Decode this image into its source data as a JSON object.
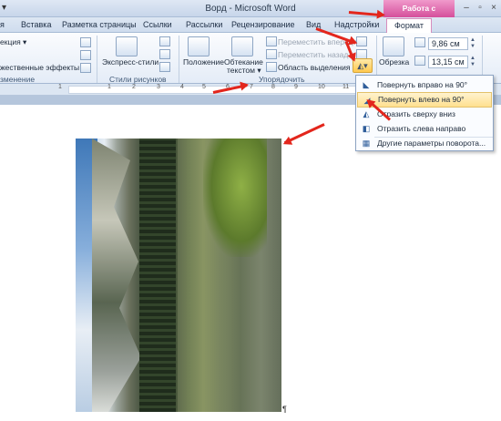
{
  "window": {
    "title": "Ворд - Microsoft Word",
    "qat_glyph": "▾",
    "controls": [
      "–",
      "▫",
      "×"
    ]
  },
  "contextual_tab": {
    "group": "Работа с рисунками",
    "tab": "Формат",
    "color": "#d54f9b"
  },
  "tabs": [
    "я",
    "Вставка",
    "Разметка страницы",
    "Ссылки",
    "Рассылки",
    "Рецензирование",
    "Вид",
    "Надстройки"
  ],
  "ribbon": {
    "adjust": {
      "items": [
        "екция ▾",
        "",
        "жественные эффекты ▾"
      ],
      "label": "зменение"
    },
    "styles": {
      "express": "Экспресс-стили",
      "label": "Стили рисунков"
    },
    "arrange": {
      "position": "Положение",
      "wrap": "Обтекание",
      "wrap2": "текстом ▾",
      "forward": "Переместить вперед ▾",
      "backward": "Переместить назад ▾",
      "selection_pane": "Область выделения",
      "label": "Упорядочить"
    },
    "size": {
      "crop": "Обрезка",
      "height": "9,86 см",
      "width": "13,15 см"
    }
  },
  "ruler": {
    "numbers": [
      "1",
      "1",
      "2",
      "3",
      "4",
      "5",
      "6",
      "7",
      "8",
      "9",
      "10",
      "11",
      "12"
    ]
  },
  "rotate_menu": {
    "items": [
      {
        "label": "Повернуть вправо на 90°",
        "icon": "rotate-right-icon",
        "glyph": "◣",
        "highlighted": false
      },
      {
        "label": "Повернуть влево на 90°",
        "icon": "rotate-left-icon",
        "glyph": "◢",
        "highlighted": true
      },
      {
        "label": "Отразить сверху вниз",
        "icon": "flip-vertical-icon",
        "glyph": "◭",
        "highlighted": false
      },
      {
        "label": "Отразить слева направо",
        "icon": "flip-horizontal-icon",
        "glyph": "◧",
        "highlighted": false
      },
      {
        "label": "Другие параметры поворота...",
        "icon": "rotation-options-icon",
        "glyph": "▦",
        "highlighted": false
      }
    ]
  },
  "document": {
    "pilcrow": "¶"
  },
  "colors": {
    "accent": "#e3261c",
    "highlight": "#ffe08f"
  }
}
